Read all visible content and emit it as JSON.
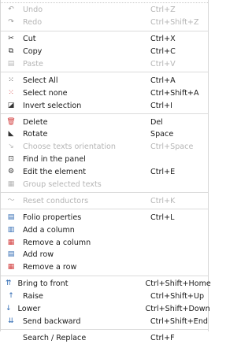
{
  "menu": {
    "undo": {
      "label": "Undo",
      "shortcut": "Ctrl+Z",
      "icon": "undo-icon"
    },
    "redo": {
      "label": "Redo",
      "shortcut": "Ctrl+Shift+Z",
      "icon": "redo-icon"
    },
    "cut": {
      "label": "Cut",
      "shortcut": "Ctrl+X",
      "icon": "scissors-icon"
    },
    "copy": {
      "label": "Copy",
      "shortcut": "Ctrl+C",
      "icon": "copy-icon"
    },
    "paste": {
      "label": "Paste",
      "shortcut": "Ctrl+V",
      "icon": "paste-icon"
    },
    "select_all": {
      "label": "Select All",
      "shortcut": "Ctrl+A",
      "icon": "select-all-icon"
    },
    "select_none": {
      "label": "Select none",
      "shortcut": "Ctrl+Shift+A",
      "icon": "select-none-icon"
    },
    "invert_selection": {
      "label": "Invert selection",
      "shortcut": "Ctrl+I",
      "icon": "invert-selection-icon"
    },
    "delete": {
      "label": "Delete",
      "shortcut": "Del",
      "icon": "trash-icon"
    },
    "rotate": {
      "label": "Rotate",
      "shortcut": "Space",
      "icon": "rotate-icon"
    },
    "choose_texts_orientation": {
      "label": "Choose texts orientation",
      "shortcut": "Ctrl+Space",
      "icon": "text-orientation-icon"
    },
    "find_in_panel": {
      "label": "Find in the panel",
      "shortcut": "",
      "icon": "find-icon"
    },
    "edit_element": {
      "label": "Edit the element",
      "shortcut": "Ctrl+E",
      "icon": "edit-element-icon"
    },
    "group_selected_texts": {
      "label": "Group selected texts",
      "shortcut": "",
      "icon": "group-icon"
    },
    "reset_conductors": {
      "label": "Reset conductors",
      "shortcut": "Ctrl+K",
      "icon": "conductor-icon"
    },
    "folio_properties": {
      "label": "Folio properties",
      "shortcut": "Ctrl+L",
      "icon": "folio-properties-icon"
    },
    "add_column": {
      "label": "Add a column",
      "shortcut": "",
      "icon": "add-column-icon"
    },
    "remove_column": {
      "label": "Remove a column",
      "shortcut": "",
      "icon": "remove-column-icon"
    },
    "add_row": {
      "label": "Add row",
      "shortcut": "",
      "icon": "add-row-icon"
    },
    "remove_row": {
      "label": "Remove a row",
      "shortcut": "",
      "icon": "remove-row-icon"
    },
    "bring_to_front": {
      "label": "Bring to front",
      "shortcut": "Ctrl+Shift+Home",
      "icon": "bring-to-front-icon"
    },
    "raise": {
      "label": "Raise",
      "shortcut": "Ctrl+Shift+Up",
      "icon": "raise-icon"
    },
    "lower": {
      "label": "Lower",
      "shortcut": "Ctrl+Shift+Down",
      "icon": "lower-icon"
    },
    "send_backward": {
      "label": "Send backward",
      "shortcut": "Ctrl+Shift+End",
      "icon": "send-backward-icon"
    },
    "search_replace": {
      "label": "Search / Replace",
      "shortcut": "Ctrl+F",
      "icon": ""
    }
  },
  "colors": {
    "text": "#1a1a1a",
    "disabled": "#b5b5b5",
    "separator": "#dcdcdc",
    "delete_icon": "#d23c3c"
  }
}
